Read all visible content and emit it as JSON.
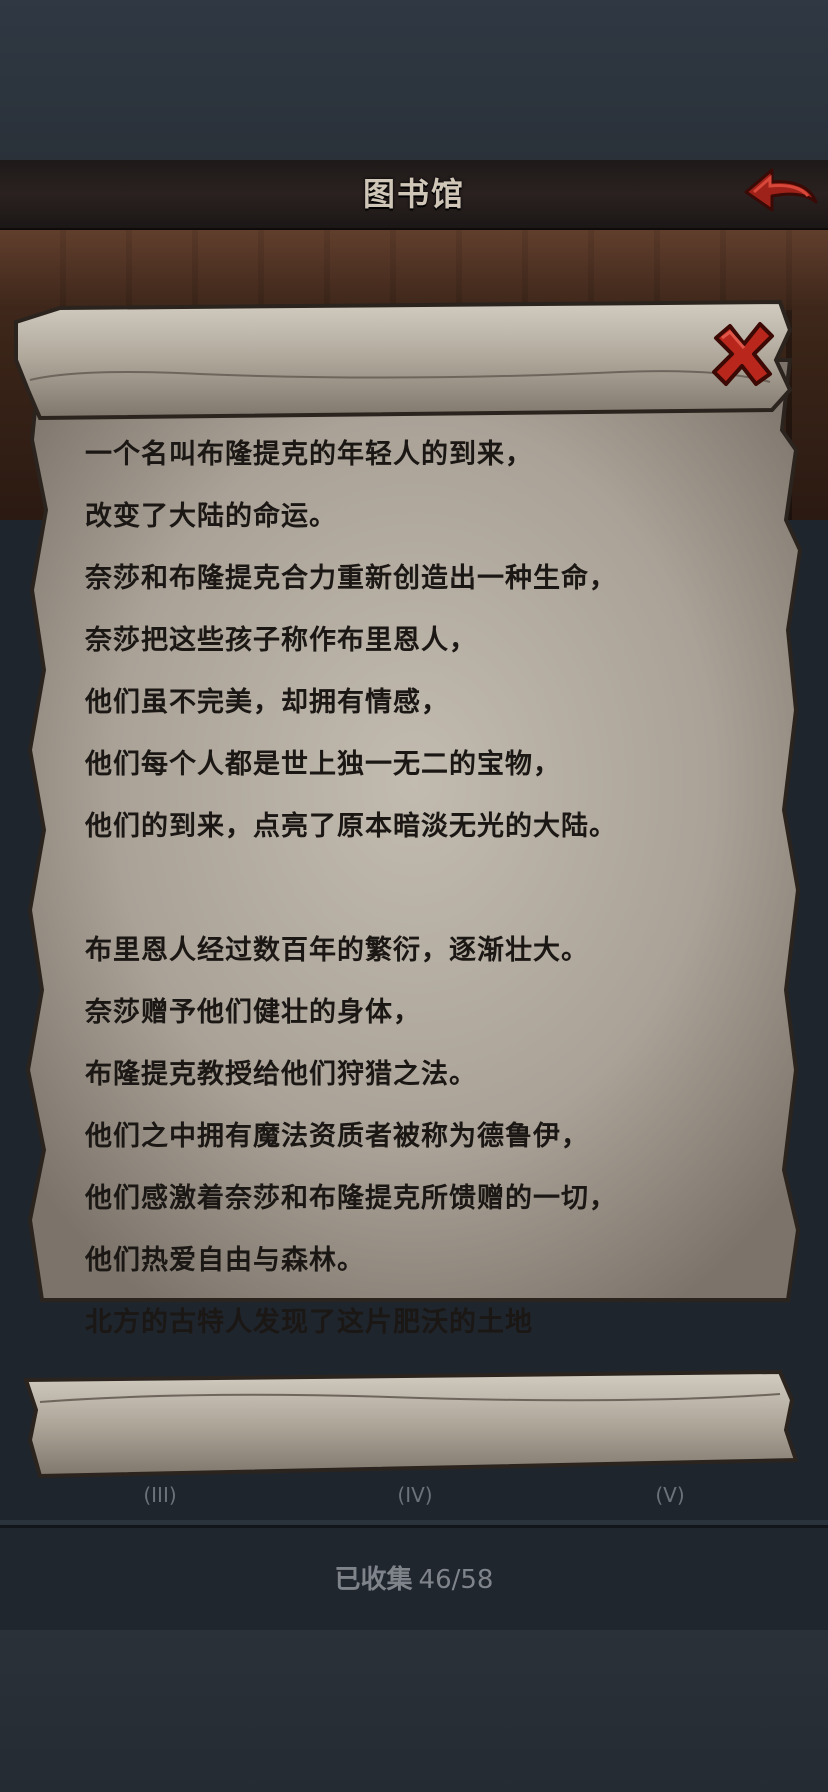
{
  "header": {
    "title": "图书馆"
  },
  "scroll": {
    "lines": [
      "一个名叫布隆提克的年轻人的到来，",
      "改变了大陆的命运。",
      "奈莎和布隆提克合力重新创造出一种生命，",
      "奈莎把这些孩子称作布里恩人，",
      "他们虽不完美，却拥有情感，",
      "他们每个人都是世上独一无二的宝物，",
      "他们的到来，点亮了原本暗淡无光的大陆。",
      "",
      "布里恩人经过数百年的繁衍，逐渐壮大。",
      "奈莎赠予他们健壮的身体，",
      "布隆提克教授给他们狩猎之法。",
      "他们之中拥有魔法资质者被称为德鲁伊，",
      "他们感激着奈莎和布隆提克所馈赠的一切，",
      "他们热爱自由与森林。",
      "北方的古特人发现了这片肥沃的土地"
    ]
  },
  "volumes": {
    "labels": [
      "(III)",
      "(IV)",
      "(V)"
    ]
  },
  "footer": {
    "collected_label": "已收集",
    "collected_count": "46/58"
  },
  "colors": {
    "back_arrow": "#a0241c",
    "close_x": "#b8261c",
    "parchment": "#b7b0a4",
    "ink": "#1b1714"
  },
  "icons": {
    "back": "back-arrow-icon",
    "close": "close-x-icon"
  }
}
